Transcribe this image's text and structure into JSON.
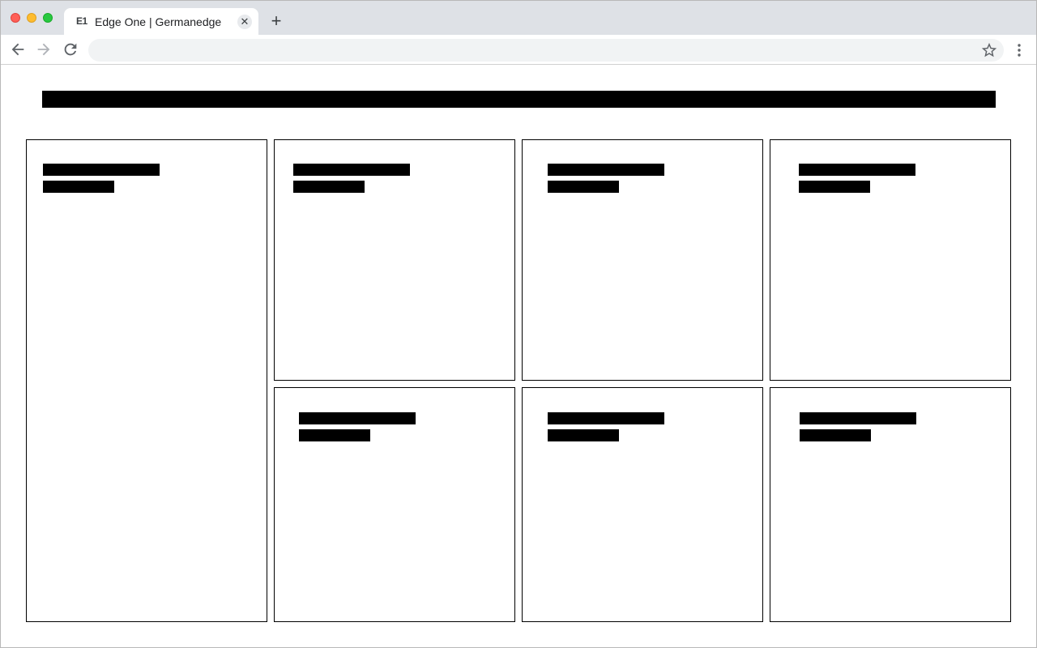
{
  "browser": {
    "tab": {
      "favicon_text": "E1",
      "title": "Edge One | Germanedge",
      "close_glyph": "✕"
    },
    "new_tab_glyph": "+",
    "address_bar": {
      "value": "",
      "placeholder": ""
    },
    "icons": [
      "arrow-left-icon",
      "arrow-right-icon",
      "reload-icon",
      "star-icon",
      "more-vert-icon"
    ]
  },
  "page": {
    "cards": [
      {
        "id": "card-1"
      },
      {
        "id": "card-2"
      },
      {
        "id": "card-3"
      },
      {
        "id": "card-4"
      },
      {
        "id": "card-5"
      },
      {
        "id": "card-6"
      },
      {
        "id": "card-7"
      }
    ]
  },
  "colors": {
    "tabstrip": "#dee1e6",
    "placeholder_block": "#000000"
  }
}
